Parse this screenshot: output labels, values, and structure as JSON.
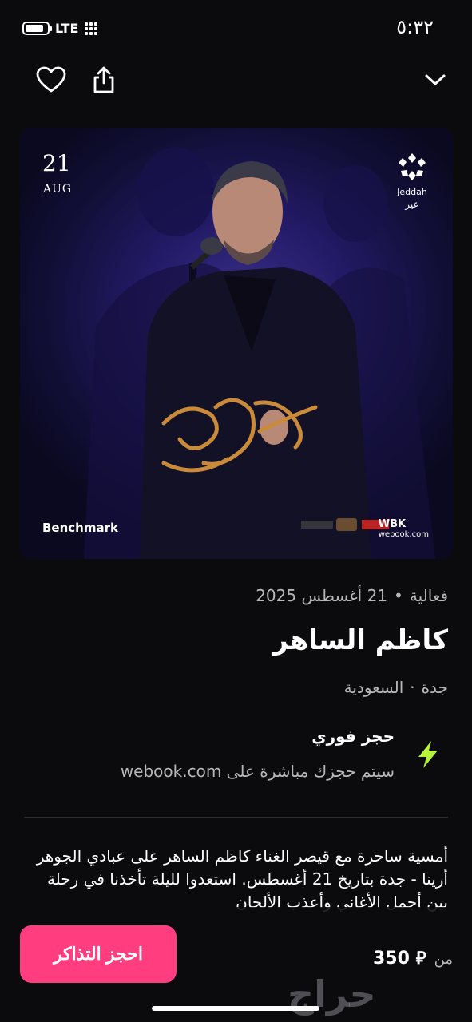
{
  "status_bar": {
    "network": "LTE",
    "time": "٥:٣٢",
    "battery_level": 0.85
  },
  "hero": {
    "date_day": "21",
    "date_month": "AUG",
    "brand": "Benchmark",
    "logo_text": "Jeddah",
    "logo_subtext": "عير",
    "partner": "webook.com",
    "partner_label": "WBK"
  },
  "event": {
    "category": "فعالية",
    "date": "21 أغسطس 2025",
    "title": "كاظم الساهر",
    "city": "جدة",
    "country": "السعودية"
  },
  "instant_booking": {
    "title": "حجز فوري",
    "subtitle": "سيتم حجزك مباشرة على webook.com"
  },
  "description": "أمسية ساحرة مع قيصر الغناء كاظم الساهر على عبادي الجوهر أرينا - جدة بتاريخ 21 أغسطس. استعدوا لليلة تأخذنا في رحلة بين أجمل الأغاني وأعذب الألحان",
  "bottom_bar": {
    "book_button": "احجز التذاكر",
    "price_prefix": "من",
    "price": "350 ⃁"
  },
  "watermark": "حراج",
  "colors": {
    "accent": "#ff3d7f",
    "bolt": "#b6f23a",
    "background": "#0b0b0d"
  }
}
